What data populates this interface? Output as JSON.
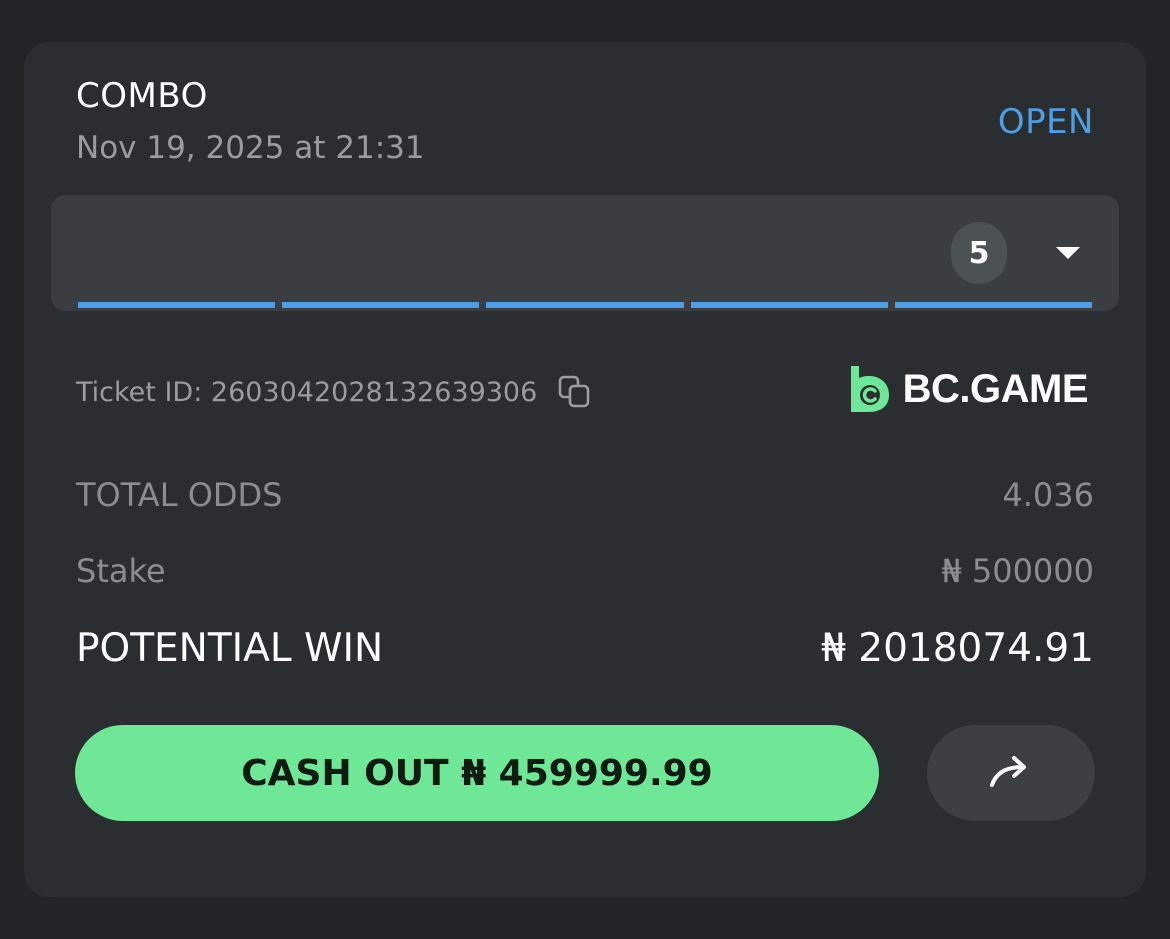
{
  "bet": {
    "type": "COMBO",
    "date": "Nov 19, 2025 at 21:31",
    "status": "OPEN"
  },
  "selections": {
    "count": "5",
    "segments": 5,
    "segment_color": "#4c9fe6"
  },
  "ticket": {
    "label": "Ticket ID: 2603042028132639306",
    "copy_icon": "copy-icon"
  },
  "brand": {
    "name": "BC.GAME",
    "logo_color": "#6ee797"
  },
  "summary": {
    "odds_label": "TOTAL ODDS",
    "odds_value": "4.036",
    "stake_label": "Stake",
    "stake_value": "₦ 500000",
    "win_label": "POTENTIAL WIN",
    "win_value": "₦ 2018074.91"
  },
  "actions": {
    "cashout_label": "CASH OUT ₦ 459999.99",
    "cashout_color": "#6ee797",
    "share_icon": "share-arrow-icon"
  }
}
